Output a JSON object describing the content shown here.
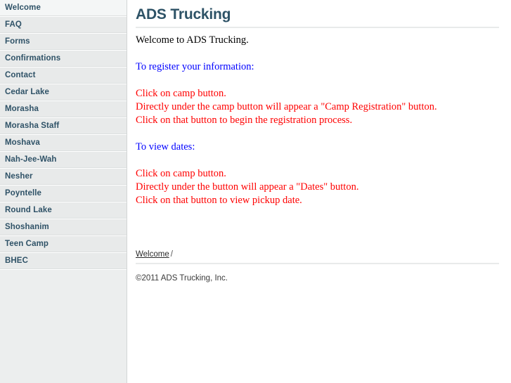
{
  "sidebar": {
    "items": [
      {
        "label": "Welcome",
        "active": true
      },
      {
        "label": "FAQ",
        "active": false
      },
      {
        "label": "Forms",
        "active": false
      },
      {
        "label": "Confirmations",
        "active": false
      },
      {
        "label": "Contact",
        "active": false
      },
      {
        "label": "Cedar Lake",
        "active": false
      },
      {
        "label": "Morasha",
        "active": false
      },
      {
        "label": "Morasha Staff",
        "active": false
      },
      {
        "label": "Moshava",
        "active": false
      },
      {
        "label": "Nah-Jee-Wah",
        "active": false
      },
      {
        "label": "Nesher",
        "active": false
      },
      {
        "label": "Poyntelle",
        "active": false
      },
      {
        "label": "Round Lake",
        "active": false
      },
      {
        "label": "Shoshanim",
        "active": false
      },
      {
        "label": "Teen Camp",
        "active": false
      },
      {
        "label": "BHEC",
        "active": false
      }
    ]
  },
  "main": {
    "title": "ADS Trucking",
    "intro": "Welcome to ADS Trucking.",
    "register_heading": "To register your information:",
    "register_steps": [
      "Click on camp button.",
      "Directly under the camp button will appear a \"Camp Registration\" button.",
      "Click on that button to begin the registration process."
    ],
    "dates_heading": "To view dates:",
    "dates_steps": [
      "Click on camp button.",
      "Directly under the button will appear a \"Dates\" button.",
      "Click on that button to view pickup date."
    ]
  },
  "footer": {
    "breadcrumb_link": "Welcome",
    "breadcrumb_separator": "/",
    "copyright": "©2011 ADS Trucking, Inc."
  },
  "colors": {
    "heading": "#2d5266",
    "sidebar_text": "#2f5267",
    "blue_text": "#0000ff",
    "red_text": "#ff0000",
    "sidebar_bg": "#e8eaea",
    "sidebar_active_bg": "#f4f6f6"
  }
}
